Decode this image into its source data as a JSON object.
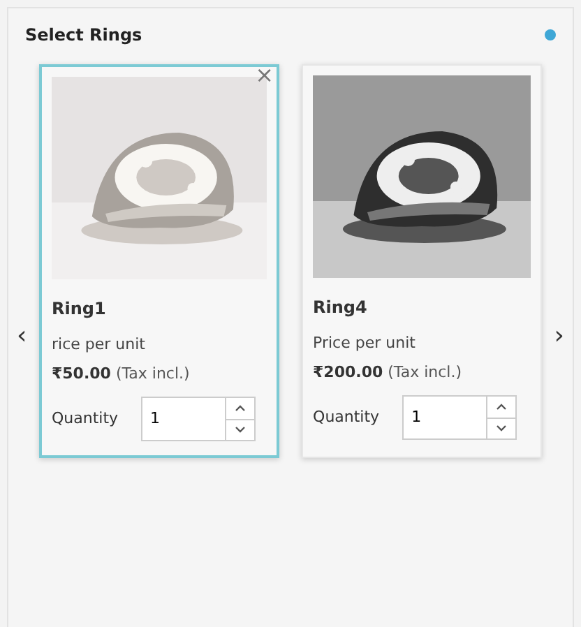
{
  "panel": {
    "title": "Select Rings",
    "info_dot": {
      "color": "#3fa7d6"
    }
  },
  "carousel": {
    "prev": "‹",
    "next": "›"
  },
  "cards": [
    {
      "name": "Ring1",
      "price_label": "rice per unit",
      "price": "₹50.00",
      "tax_note": "(Tax incl.)",
      "quantity_label": "Quantity",
      "quantity": "1",
      "selected": true,
      "remove": "×"
    },
    {
      "name": "Ring4",
      "price_label": "Price per unit",
      "price": "₹200.00",
      "tax_note": "(Tax incl.)",
      "quantity_label": "Quantity",
      "quantity": "1",
      "selected": false
    }
  ]
}
